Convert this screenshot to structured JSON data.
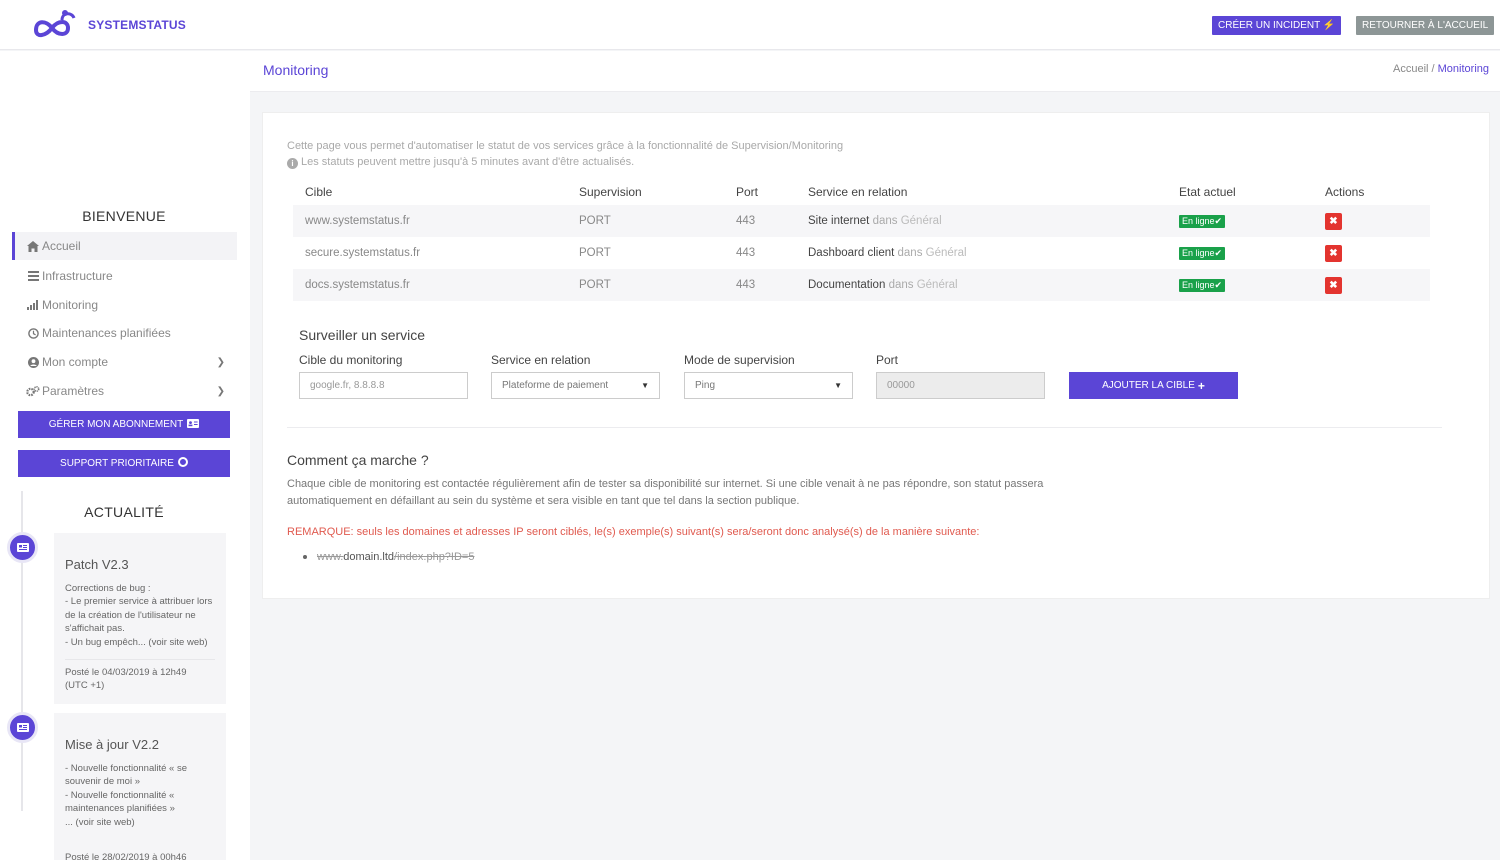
{
  "brand": {
    "name": "SYSTEMSTATUS",
    "color": "#5b45d6"
  },
  "topbar": {
    "create_incident": "CRÉER UN INCIDENT",
    "back_home": "RETOURNER À L'ACCUEIL"
  },
  "header": {
    "title": "Monitoring",
    "breadcrumb_home": "Accueil",
    "breadcrumb_sep": " / ",
    "breadcrumb_current": "Monitoring"
  },
  "sidebar": {
    "welcome_title": "BIENVENUE",
    "items": [
      {
        "label": "Accueil",
        "icon": "home-icon"
      },
      {
        "label": "Infrastructure",
        "icon": "server-icon"
      },
      {
        "label": "Monitoring",
        "icon": "signal-bars-icon"
      },
      {
        "label": "Maintenances planifiées",
        "icon": "clock-icon"
      },
      {
        "label": "Mon compte",
        "icon": "user-circle-icon"
      },
      {
        "label": "Paramètres",
        "icon": "gears-icon"
      }
    ],
    "manage_subscription": "GÉRER MON ABONNEMENT",
    "priority_support": "SUPPORT PRIORITAIRE",
    "news_title": "ACTUALITÉ",
    "news": [
      {
        "title": "Patch V2.3",
        "body": "Corrections de bug :\n- Le premier service à attribuer lors de la création de l'utilisateur ne s'affichait pas.\n- Un bug empêch... (voir site web)",
        "posted": "Posté le 04/03/2019 à 12h49\n(UTC +1)"
      },
      {
        "title": "Mise à jour V2.2",
        "body": "- Nouvelle fonctionnalité « se souvenir de moi »\n- Nouvelle fonctionnalité « maintenances planifiées »\n... (voir site web)",
        "posted": "Posté le 28/02/2019 à 00h46"
      }
    ]
  },
  "main": {
    "intro_line1": "Cette page vous permet d'automatiser le statut de vos services grâce à la fonctionnalité de Supervision/Monitoring",
    "intro_line2": "Les statuts peuvent mettre jusqu'à 5 minutes avant d'être actualisés.",
    "table": {
      "headers": [
        "Cible",
        "Supervision",
        "Port",
        "Service en relation",
        "Etat actuel",
        "Actions"
      ],
      "rows": [
        {
          "target": "www.systemstatus.fr",
          "supervision": "PORT",
          "port": "443",
          "service": "Site internet",
          "in_word": "dans",
          "category": "Général",
          "status": "En ligne"
        },
        {
          "target": "secure.systemstatus.fr",
          "supervision": "PORT",
          "port": "443",
          "service": "Dashboard client",
          "in_word": "dans",
          "category": "Général",
          "status": "En ligne"
        },
        {
          "target": "docs.systemstatus.fr",
          "supervision": "PORT",
          "port": "443",
          "service": "Documentation",
          "in_word": "dans",
          "category": "Général",
          "status": "En ligne"
        }
      ]
    },
    "form": {
      "title": "Surveiller un service",
      "target_label": "Cible du monitoring",
      "target_placeholder": "google.fr, 8.8.8.8",
      "service_label": "Service en relation",
      "service_value": "Plateforme de paiement",
      "mode_label": "Mode de supervision",
      "mode_value": "Ping",
      "port_label": "Port",
      "port_placeholder": "00000",
      "add_button": "AJOUTER LA CIBLE"
    },
    "how": {
      "title": "Comment ça marche ?",
      "text": "Chaque cible de monitoring est contactée régulièrement afin de tester sa disponibilité sur internet. Si une cible venait à ne pas répondre, son statut passera automatiquement en défaillant au sein du système et sera visible en tant que tel dans la section publique.",
      "remark": "REMARQUE: seuls les domaines et adresses IP seront ciblés, le(s) exemple(s) suivant(s) sera/seront donc analysé(s) de la manière suivante:",
      "example_prefix": "www.",
      "example_keep": "domain.ltd",
      "example_suffix": "/index.php?ID=5"
    }
  },
  "colors": {
    "accent": "#5b45d6",
    "success": "#1aa14a",
    "danger": "#e3342f",
    "remark": "#e05a4f"
  }
}
